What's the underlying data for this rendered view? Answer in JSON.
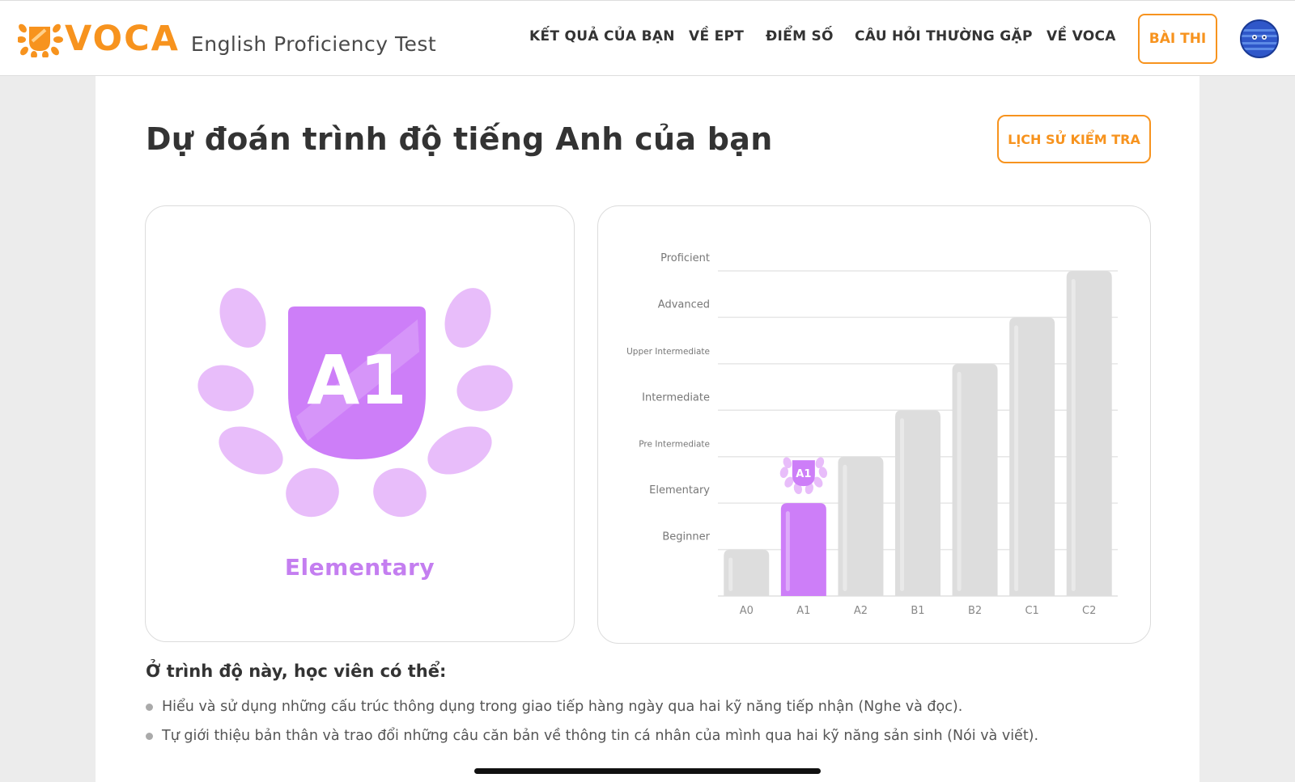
{
  "brand": {
    "logo_text": "VOCA",
    "subtitle": "English Proficiency Test",
    "accent_color": "#f7931e"
  },
  "nav": {
    "items": [
      {
        "label": "KẾT QUẢ CỦA BẠN"
      },
      {
        "label": "VỀ EPT"
      },
      {
        "label": "ĐIỂM SỐ"
      },
      {
        "label": "CÂU HỎI THƯỜNG GẶP"
      },
      {
        "label": "VỀ VOCA"
      }
    ],
    "exam_button": "BÀI THI",
    "avatar_icon": "user-avatar-icon"
  },
  "page": {
    "title": "Dự đoán trình độ tiếng Anh của bạn",
    "history_button": "LỊCH SỬ KIỂM TRA"
  },
  "result": {
    "badge_text": "A1",
    "level_name": "Elementary",
    "badge_color": "#cd7ef8",
    "leaf_color": "#e8bdfa"
  },
  "chart_data": {
    "type": "bar",
    "categories": [
      "A0",
      "A1",
      "A2",
      "B1",
      "B2",
      "C1",
      "C2"
    ],
    "values": [
      1,
      2,
      3,
      4,
      5,
      6,
      7
    ],
    "highlight_index": 1,
    "highlight_badge": "A1",
    "y_levels": [
      "Beginner",
      "Elementary",
      "Pre Intermediate",
      "Intermediate",
      "Upper Intermediate",
      "Advanced",
      "Proficient"
    ],
    "ylim": [
      0,
      7
    ],
    "grid": true,
    "bar_color": "#dddddd",
    "highlight_color": "#cd7ef8"
  },
  "description": {
    "title": "Ở trình độ này, học viên có thể:",
    "items": [
      "Hiểu và sử dụng những cấu trúc thông dụng trong giao tiếp hàng ngày qua hai kỹ năng tiếp nhận (Nghe và đọc).",
      "Tự giới thiệu bản thân và trao đổi những câu căn bản về thông tin cá nhân của mình qua hai kỹ năng sản sinh (Nói và viết)."
    ]
  }
}
